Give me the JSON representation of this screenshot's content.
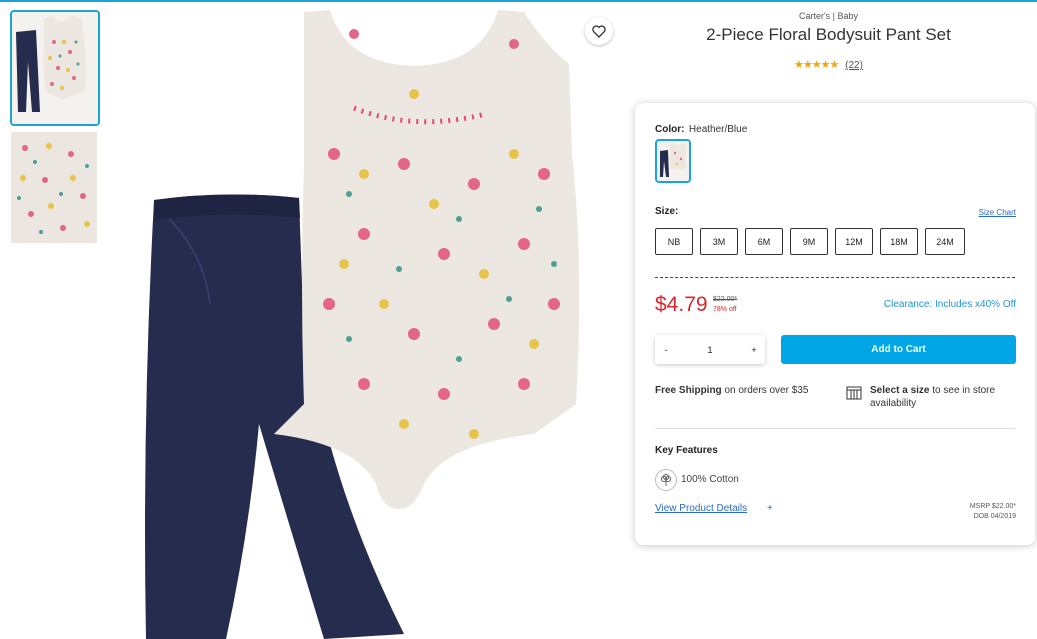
{
  "product": {
    "brand": "Carter's | Baby",
    "title": "2-Piece Floral Bodysuit Pant Set",
    "stars": "★★★★★",
    "review_count": "(22)"
  },
  "color": {
    "label": "Color:",
    "value": "Heather/Blue"
  },
  "size": {
    "label": "Size:",
    "chart_link": "Size Chart",
    "options": [
      "NB",
      "3M",
      "6M",
      "9M",
      "12M",
      "18M",
      "24M"
    ]
  },
  "pricing": {
    "price": "$4.79",
    "original": "$22.00*",
    "discount": "78% off",
    "clearance": "Clearance: Includes x40% Off"
  },
  "quantity": {
    "minus": "-",
    "value": "1",
    "plus": "+"
  },
  "cart": {
    "add_label": "Add to Cart"
  },
  "shipping": {
    "bold": "Free Shipping",
    "rest": " on orders over $35"
  },
  "store": {
    "bold": "Select a size",
    "rest": " to see in store availability"
  },
  "features": {
    "heading": "Key Features",
    "items": [
      "100% Cotton"
    ]
  },
  "details": {
    "link": "View Product Details",
    "plus": "+",
    "msrp": "MSRP $22.00*",
    "dob": "DOB 04/2019"
  },
  "colors": {
    "accent": "#00a6e6",
    "sale_red": "#d9262b",
    "link_blue": "#2a6bc7",
    "star": "#f0a30a",
    "denim": "#262c4e",
    "bodysuit": "#ece7e0"
  },
  "icons": {
    "favorite": "heart-icon",
    "store": "store-icon",
    "cotton": "cotton-icon"
  }
}
